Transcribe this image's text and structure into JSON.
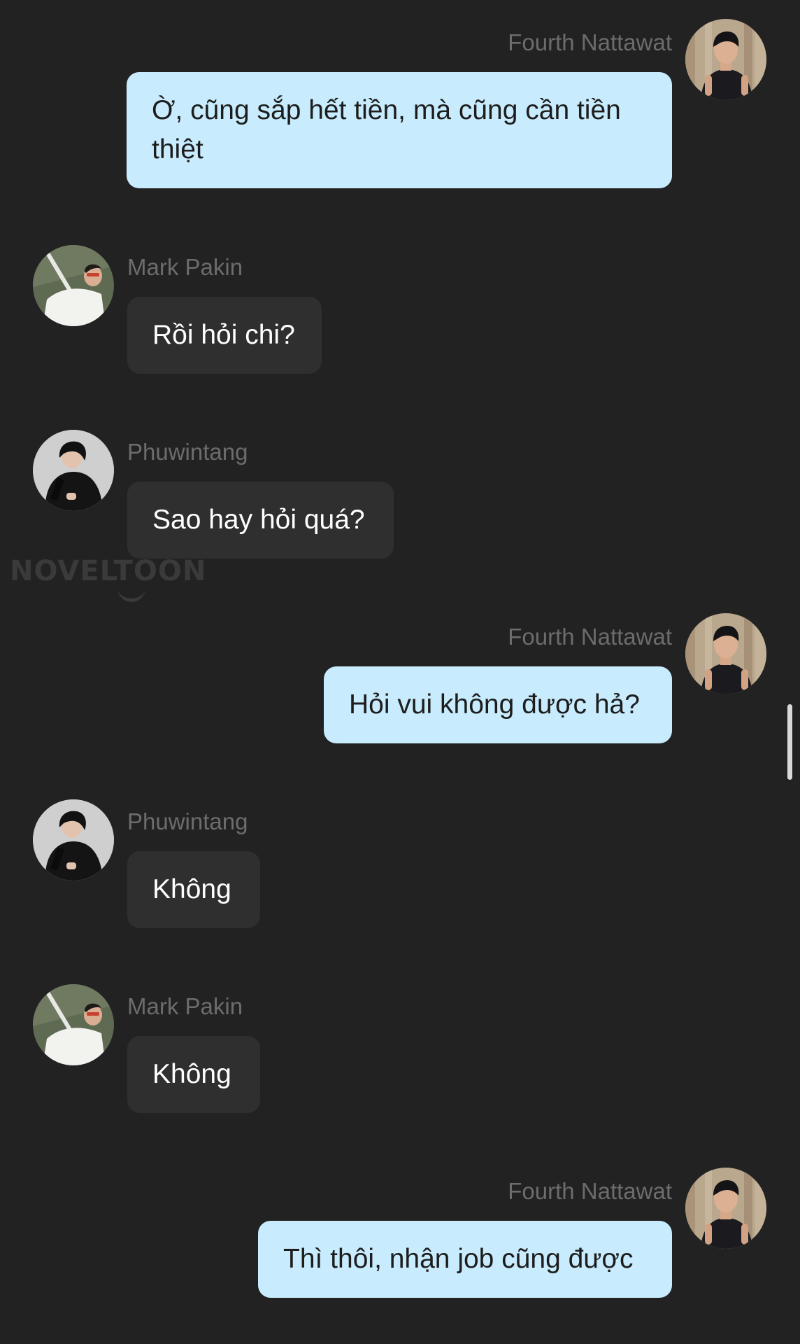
{
  "watermark": "NOVELTOON",
  "messages": [
    {
      "sender": "Fourth Nattawat",
      "avatar": "fourth-avatar",
      "direction": "out",
      "text": "Ờ, cũng sắp hết tiền, mà cũng cần tiền thiệt"
    },
    {
      "sender": "Mark Pakin",
      "avatar": "mark-avatar",
      "direction": "in",
      "text": "Rồi hỏi chi?"
    },
    {
      "sender": "Phuwintang",
      "avatar": "phuwin-avatar",
      "direction": "in",
      "text": "Sao hay hỏi quá?"
    },
    {
      "sender": "Fourth Nattawat",
      "avatar": "fourth-avatar",
      "direction": "out",
      "text": "Hỏi vui không được hả?"
    },
    {
      "sender": "Phuwintang",
      "avatar": "phuwin-avatar",
      "direction": "in",
      "text": "Không"
    },
    {
      "sender": "Mark Pakin",
      "avatar": "mark-avatar",
      "direction": "in",
      "text": "Không"
    },
    {
      "sender": "Fourth Nattawat",
      "avatar": "fourth-avatar",
      "direction": "out",
      "text": "Thì thôi, nhận job cũng được"
    }
  ],
  "colors": {
    "background": "#222222",
    "outgoing_bubble": "#c8ecfd",
    "incoming_bubble": "#2f2f2f",
    "sender_name": "#6c6c6c"
  }
}
